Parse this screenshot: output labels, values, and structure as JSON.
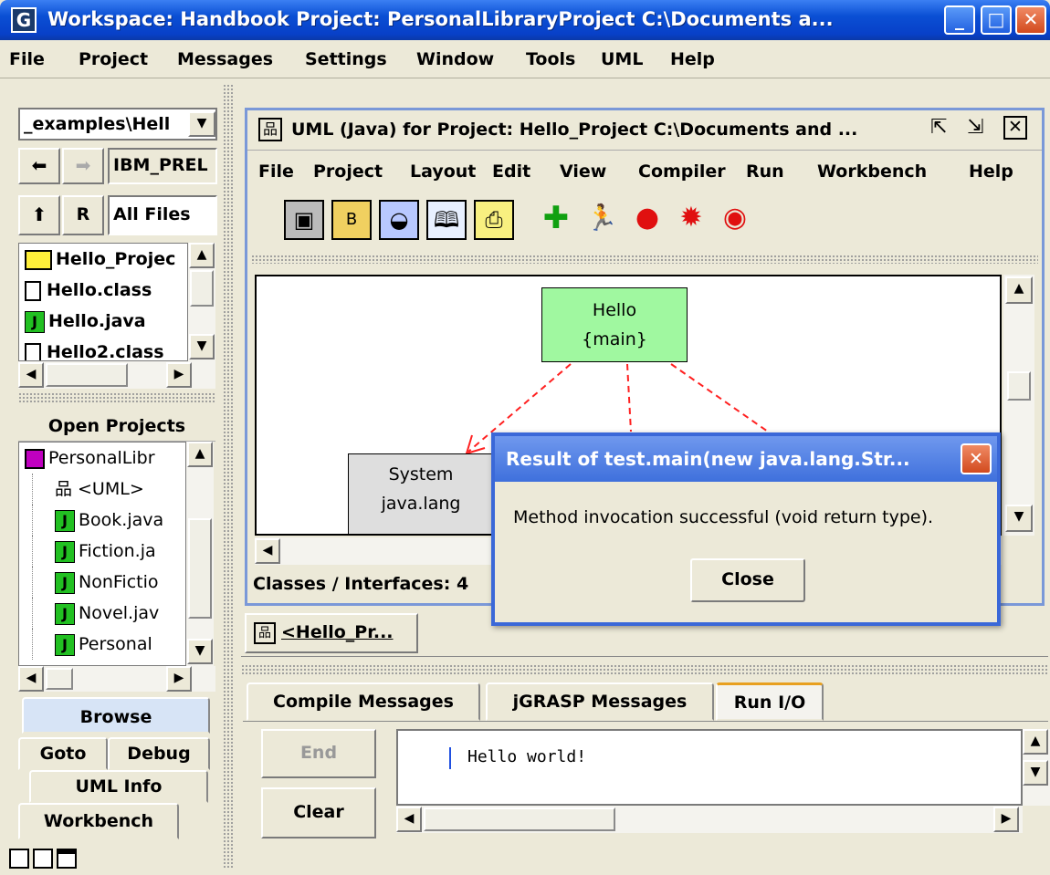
{
  "window": {
    "title": "Workspace: Handbook   Project: PersonalLibraryProject  C:\\Documents a...",
    "app_icon": "G"
  },
  "menubar": [
    "File",
    "Project",
    "Messages",
    "Settings",
    "Window",
    "Tools",
    "UML",
    "Help"
  ],
  "browse": {
    "path": "_examples\\Hell",
    "filter_field": "IBM_PREL",
    "refresh_label": "R",
    "files_filter": "All Files",
    "files": [
      {
        "name": "Hello_Projec",
        "icon": "folder-icon"
      },
      {
        "name": "Hello.class",
        "icon": "class-file-icon"
      },
      {
        "name": "Hello.java",
        "icon": "java-file-icon"
      },
      {
        "name": "Hello2.class",
        "icon": "class-file-icon"
      }
    ]
  },
  "open_projects": {
    "header": "Open Projects",
    "project": "PersonalLibr",
    "items": [
      {
        "name": "<UML>",
        "icon": "uml-icon"
      },
      {
        "name": "Book.java",
        "icon": "java-file-icon"
      },
      {
        "name": "Fiction.ja",
        "icon": "java-file-icon"
      },
      {
        "name": "NonFictio",
        "icon": "java-file-icon"
      },
      {
        "name": "Novel.jav",
        "icon": "java-file-icon"
      },
      {
        "name": "Personal",
        "icon": "java-file-icon"
      }
    ]
  },
  "left_tabs": {
    "browse": "Browse",
    "goto": "Goto",
    "debug": "Debug",
    "uml_info": "UML Info",
    "workbench": "Workbench"
  },
  "uml_window": {
    "title": "UML (Java) for Project: Hello_Project  C:\\Documents and ...",
    "menu": [
      "File",
      "Project",
      "Layout",
      "Edit",
      "View",
      "Compiler",
      "Run",
      "Workbench",
      "Help"
    ],
    "toolbar": [
      "save-icon",
      "bean-icon",
      "jar-icon",
      "book-icon",
      "print-icon",
      "add-icon",
      "run-icon",
      "apple-icon",
      "ladybug-icon",
      "apple-bug-icon"
    ],
    "nodes": {
      "hello": "Hello",
      "hello_sub": "{main}",
      "system": "System",
      "system_sub": "java.lang"
    },
    "status": "Classes / Interfaces: 4"
  },
  "window_tab": "<Hello_Pr...",
  "dialog": {
    "title": "Result of test.main(new java.lang.Str...",
    "message": "Method invocation successful (void return type).",
    "close_label": "Close"
  },
  "messages": {
    "tabs": [
      "Compile Messages",
      "jGRASP Messages",
      "Run I/O"
    ],
    "active_tab": "Run I/O",
    "end_label": "End",
    "clear_label": "Clear",
    "output": "Hello world!"
  },
  "colors": {
    "hello_node": "#a0f8a0",
    "system_node": "#dedede",
    "dialog_title": "#4f7ee8",
    "dependency": "#ff2020"
  }
}
